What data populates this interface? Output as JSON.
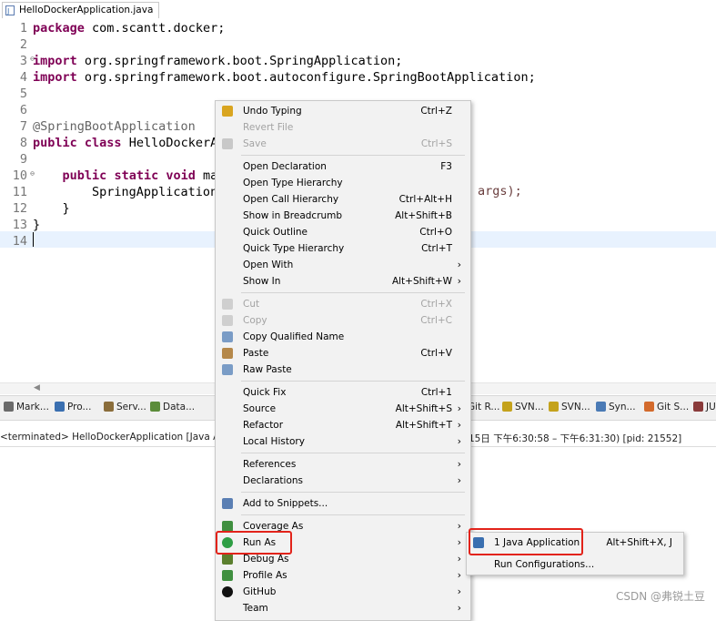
{
  "editor_tab": {
    "title": "HelloDockerApplication.java"
  },
  "code": {
    "lines": [
      {
        "no": "1",
        "parts": [
          {
            "t": "package",
            "c": "kw"
          },
          {
            "t": " com.scantt.docker;",
            "c": ""
          }
        ]
      },
      {
        "no": "2",
        "parts": []
      },
      {
        "no": "3",
        "fold": true,
        "parts": [
          {
            "t": "import",
            "c": "kw"
          },
          {
            "t": " org.springframework.boot.SpringApplication;",
            "c": ""
          }
        ]
      },
      {
        "no": "4",
        "parts": [
          {
            "t": "import",
            "c": "kw"
          },
          {
            "t": " org.springframework.boot.autoconfigure.SpringBootApplication;",
            "c": ""
          }
        ]
      },
      {
        "no": "5",
        "parts": []
      },
      {
        "no": "6",
        "parts": []
      },
      {
        "no": "7",
        "parts": [
          {
            "t": "@SpringBootApplication",
            "c": "ann"
          }
        ]
      },
      {
        "no": "8",
        "parts": [
          {
            "t": "public",
            "c": "kw"
          },
          {
            "t": " ",
            "c": ""
          },
          {
            "t": "class",
            "c": "kw"
          },
          {
            "t": " HelloDockerA",
            "c": ""
          }
        ]
      },
      {
        "no": "9",
        "parts": []
      },
      {
        "no": "10",
        "fold": true,
        "parts": [
          {
            "t": "    ",
            "c": ""
          },
          {
            "t": "public",
            "c": "kw"
          },
          {
            "t": " ",
            "c": ""
          },
          {
            "t": "static",
            "c": "kw"
          },
          {
            "t": " ",
            "c": ""
          },
          {
            "t": "void",
            "c": "kw"
          },
          {
            "t": " ma",
            "c": ""
          }
        ]
      },
      {
        "no": "11",
        "parts": [
          {
            "t": "        SpringApplication",
            "c": ""
          }
        ]
      },
      {
        "no": "12",
        "parts": [
          {
            "t": "    }",
            "c": ""
          }
        ]
      },
      {
        "no": "13",
        "parts": [
          {
            "t": "}",
            "c": ""
          }
        ]
      },
      {
        "no": "14",
        "parts": []
      }
    ],
    "line11_tail": "args);"
  },
  "views": {
    "tabs": [
      {
        "label": "Mark...",
        "color": "#6a6a6a"
      },
      {
        "label": "Pro...",
        "color": "#3a6fb0"
      },
      {
        "label": "Serv...",
        "color": "#8a6d3b"
      },
      {
        "label": "Data...",
        "color": "#5b8c3a"
      },
      {
        "label": "Git R...",
        "color": "#d36a2c"
      },
      {
        "label": "SVN...",
        "color": "#c4a21c"
      },
      {
        "label": "SVN...",
        "color": "#c4a21c"
      },
      {
        "label": "Syn...",
        "color": "#4a7ab5"
      },
      {
        "label": "Git S...",
        "color": "#d36a2c"
      },
      {
        "label": "JU",
        "color": "#8a3b3b"
      }
    ]
  },
  "console": {
    "left": "<terminated> HelloDockerApplication [Java Appli",
    "right": "15日 下午6:30:58 – 下午6:31:30) [pid: 21552]"
  },
  "context_menu": {
    "items": [
      {
        "label": "Undo Typing",
        "shortcut": "Ctrl+Z",
        "icon": "undo-icon",
        "icolor": "#d9a520"
      },
      {
        "label": "Revert File",
        "shortcut": "",
        "disabled": true
      },
      {
        "label": "Save",
        "shortcut": "Ctrl+S",
        "disabled": true,
        "icon": "save-icon",
        "icolor": "#c8c8c8"
      },
      {
        "sep": true
      },
      {
        "label": "Open Declaration",
        "shortcut": "F3"
      },
      {
        "label": "Open Type Hierarchy",
        "shortcut": ""
      },
      {
        "label": "Open Call Hierarchy",
        "shortcut": "Ctrl+Alt+H"
      },
      {
        "label": "Show in Breadcrumb",
        "shortcut": "Alt+Shift+B"
      },
      {
        "label": "Quick Outline",
        "shortcut": "Ctrl+O"
      },
      {
        "label": "Quick Type Hierarchy",
        "shortcut": "Ctrl+T"
      },
      {
        "label": "Open With",
        "shortcut": "",
        "sub": true
      },
      {
        "label": "Show In",
        "shortcut": "Alt+Shift+W",
        "sub": true
      },
      {
        "sep": true
      },
      {
        "label": "Cut",
        "shortcut": "Ctrl+X",
        "disabled": true,
        "icon": "cut-icon",
        "icolor": "#cfcfcf"
      },
      {
        "label": "Copy",
        "shortcut": "Ctrl+C",
        "disabled": true,
        "icon": "copy-icon",
        "icolor": "#cfcfcf"
      },
      {
        "label": "Copy Qualified Name",
        "shortcut": "",
        "icon": "copy-qualified-icon",
        "icolor": "#7a9cc6"
      },
      {
        "label": "Paste",
        "shortcut": "Ctrl+V",
        "icon": "paste-icon",
        "icolor": "#b5884a"
      },
      {
        "label": "Raw Paste",
        "shortcut": "",
        "icon": "raw-paste-icon",
        "icolor": "#7a9cc6"
      },
      {
        "sep": true
      },
      {
        "label": "Quick Fix",
        "shortcut": "Ctrl+1"
      },
      {
        "label": "Source",
        "shortcut": "Alt+Shift+S",
        "sub": true
      },
      {
        "label": "Refactor",
        "shortcut": "Alt+Shift+T",
        "sub": true
      },
      {
        "label": "Local History",
        "shortcut": "",
        "sub": true
      },
      {
        "sep": true
      },
      {
        "label": "References",
        "shortcut": "",
        "sub": true
      },
      {
        "label": "Declarations",
        "shortcut": "",
        "sub": true
      },
      {
        "sep": true
      },
      {
        "label": "Add to Snippets...",
        "shortcut": "",
        "icon": "snippets-icon",
        "icolor": "#5a7fb3"
      },
      {
        "sep": true
      },
      {
        "label": "Coverage As",
        "shortcut": "",
        "sub": true,
        "icon": "coverage-icon",
        "icolor": "#3f8f3f"
      },
      {
        "label": "Run As",
        "shortcut": "",
        "sub": true,
        "icon": "run-icon",
        "icolor": "#2e9e44",
        "active": true
      },
      {
        "label": "Debug As",
        "shortcut": "",
        "sub": true,
        "icon": "debug-icon",
        "icolor": "#5b7f2e"
      },
      {
        "label": "Profile As",
        "shortcut": "",
        "sub": true,
        "icon": "profile-icon",
        "icolor": "#3f8f3f"
      },
      {
        "label": "GitHub",
        "shortcut": "",
        "sub": true,
        "icon": "github-icon",
        "icolor": "#111"
      },
      {
        "label": "Team",
        "shortcut": "",
        "sub": true
      }
    ]
  },
  "submenu": {
    "items": [
      {
        "label": "1 Java Application",
        "shortcut": "Alt+Shift+X, J",
        "icon": "java-app-icon",
        "icolor": "#3a6fb0"
      },
      {
        "label": "Run Configurations...",
        "shortcut": ""
      }
    ]
  },
  "watermark": "CSDN @弗锐土豆"
}
